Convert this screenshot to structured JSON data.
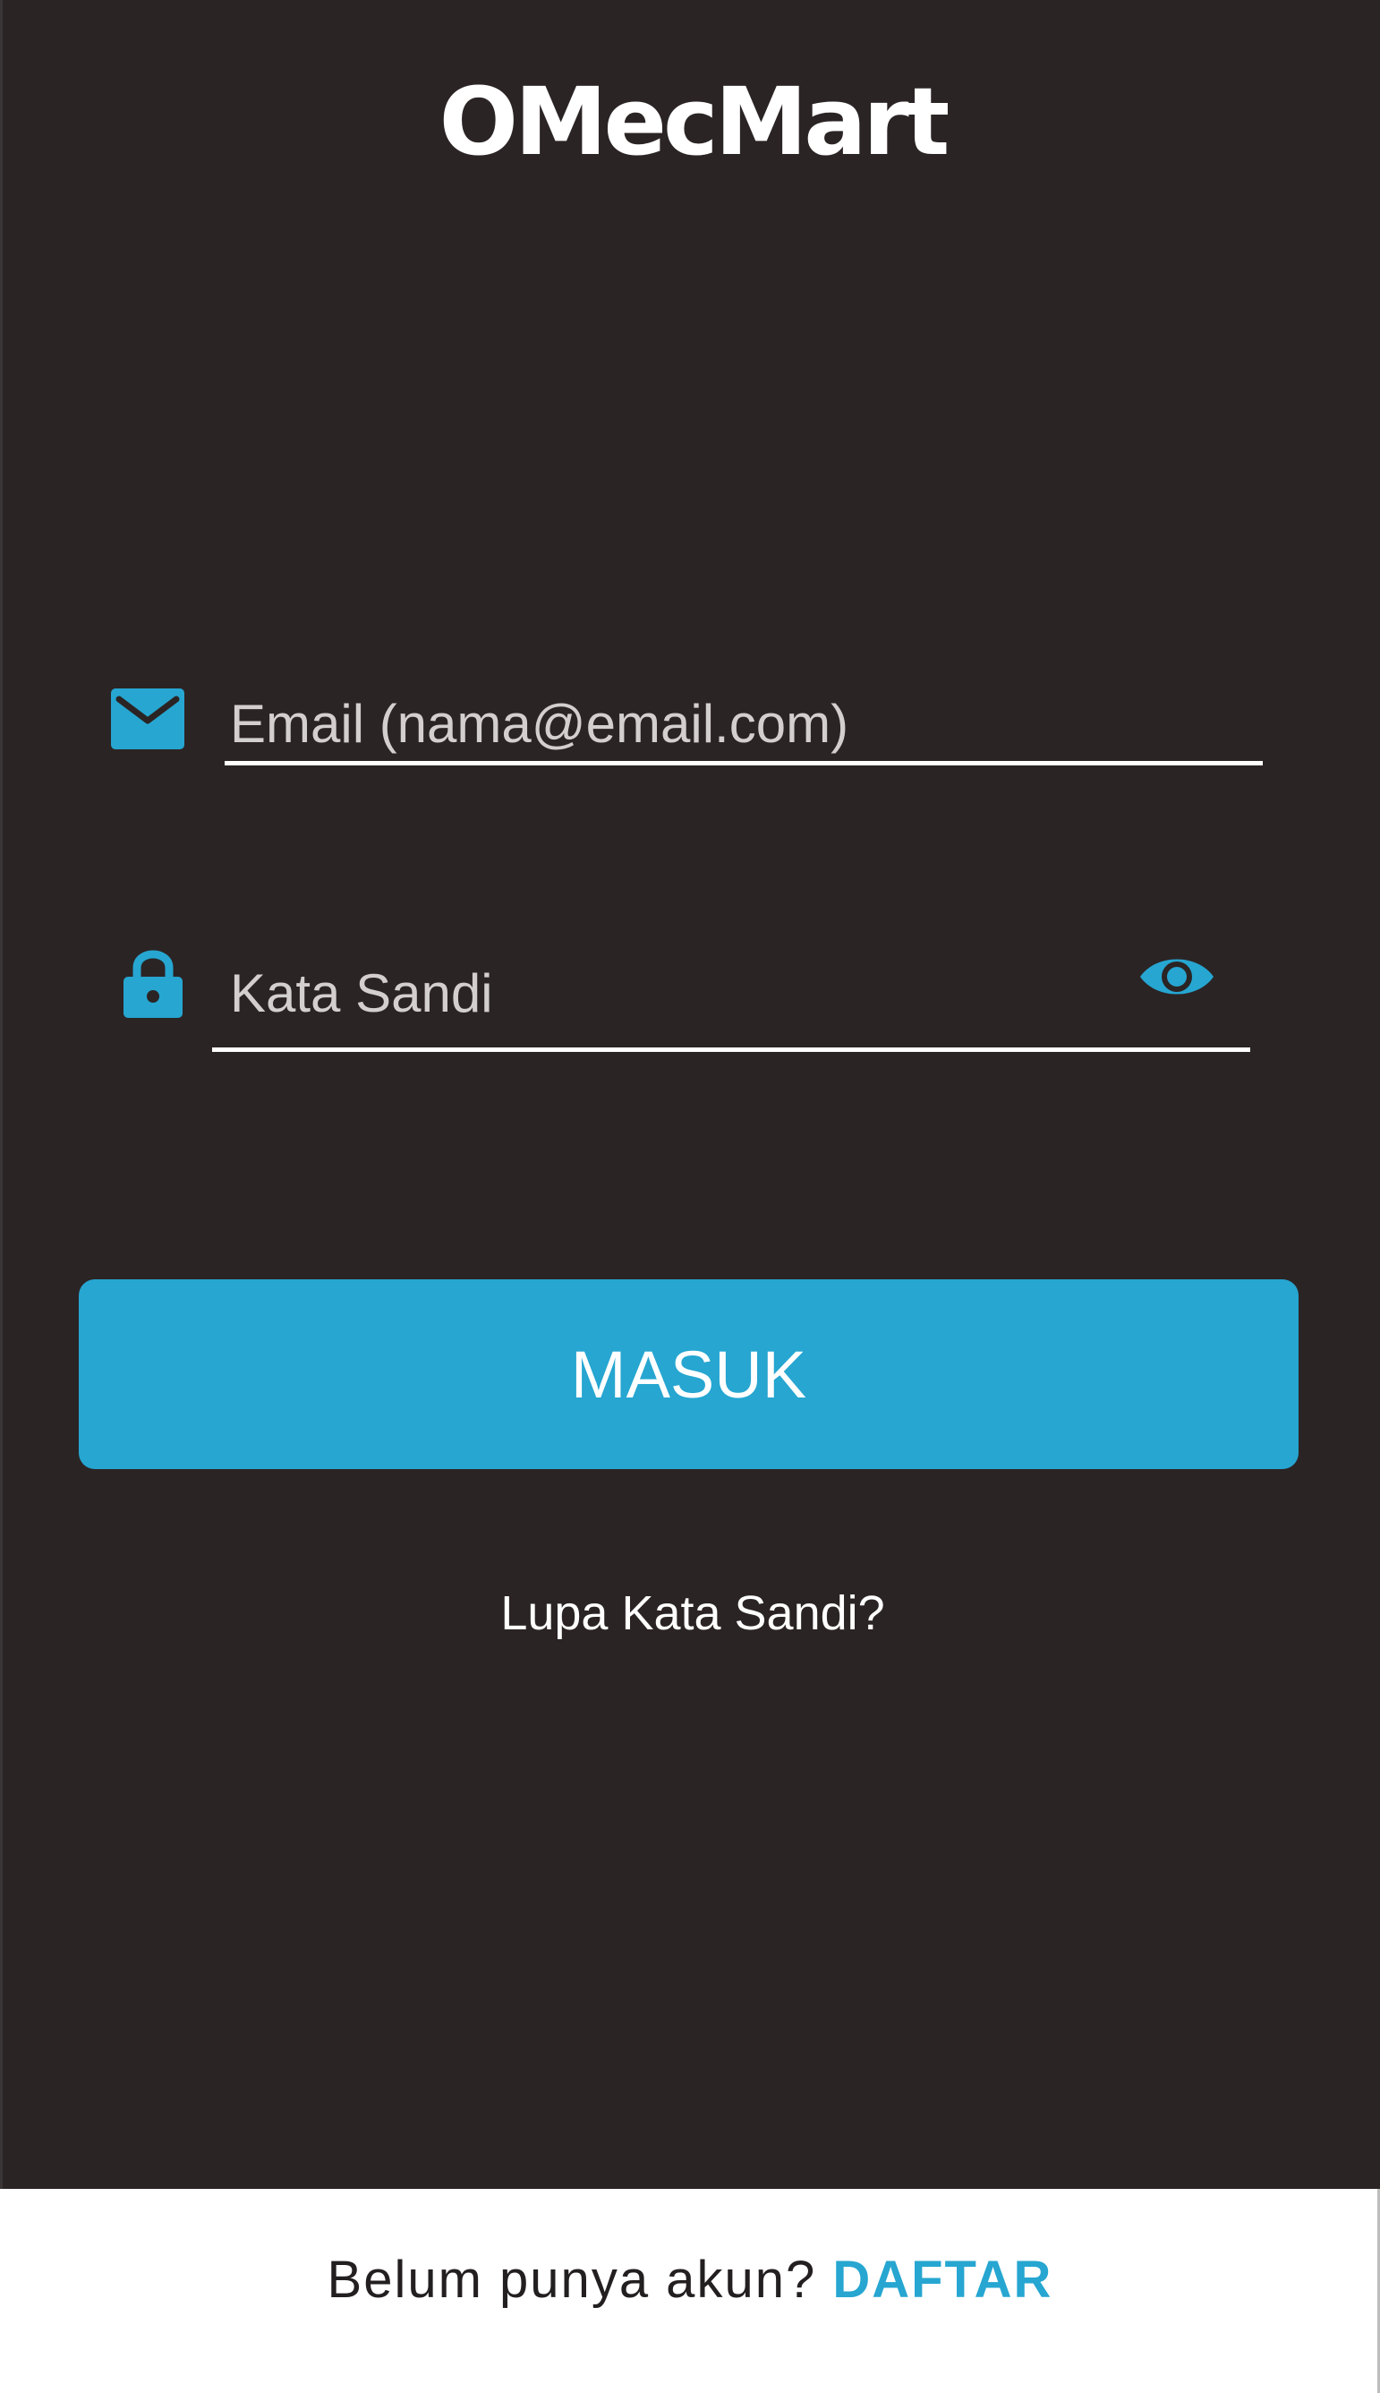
{
  "app": {
    "logo_text": "OMecMart"
  },
  "login_form": {
    "email_field": {
      "placeholder": "Email (nama@email.com)",
      "icon": "mail-icon"
    },
    "password_field": {
      "placeholder": "Kata Sandi",
      "icon": "lock-icon",
      "toggle_icon": "eye-icon"
    },
    "submit_label": "MASUK",
    "forgot_password_label": "Lupa Kata Sandi?"
  },
  "footer": {
    "register_prompt": "Belum punya akun?",
    "register_link_label": "DAFTAR"
  },
  "colors": {
    "background": "#2b2424",
    "accent": "#26a6d1",
    "text_primary": "#ffffff",
    "placeholder": "#d3cfce",
    "footer_background": "#ffffff",
    "footer_text": "#231f20"
  }
}
